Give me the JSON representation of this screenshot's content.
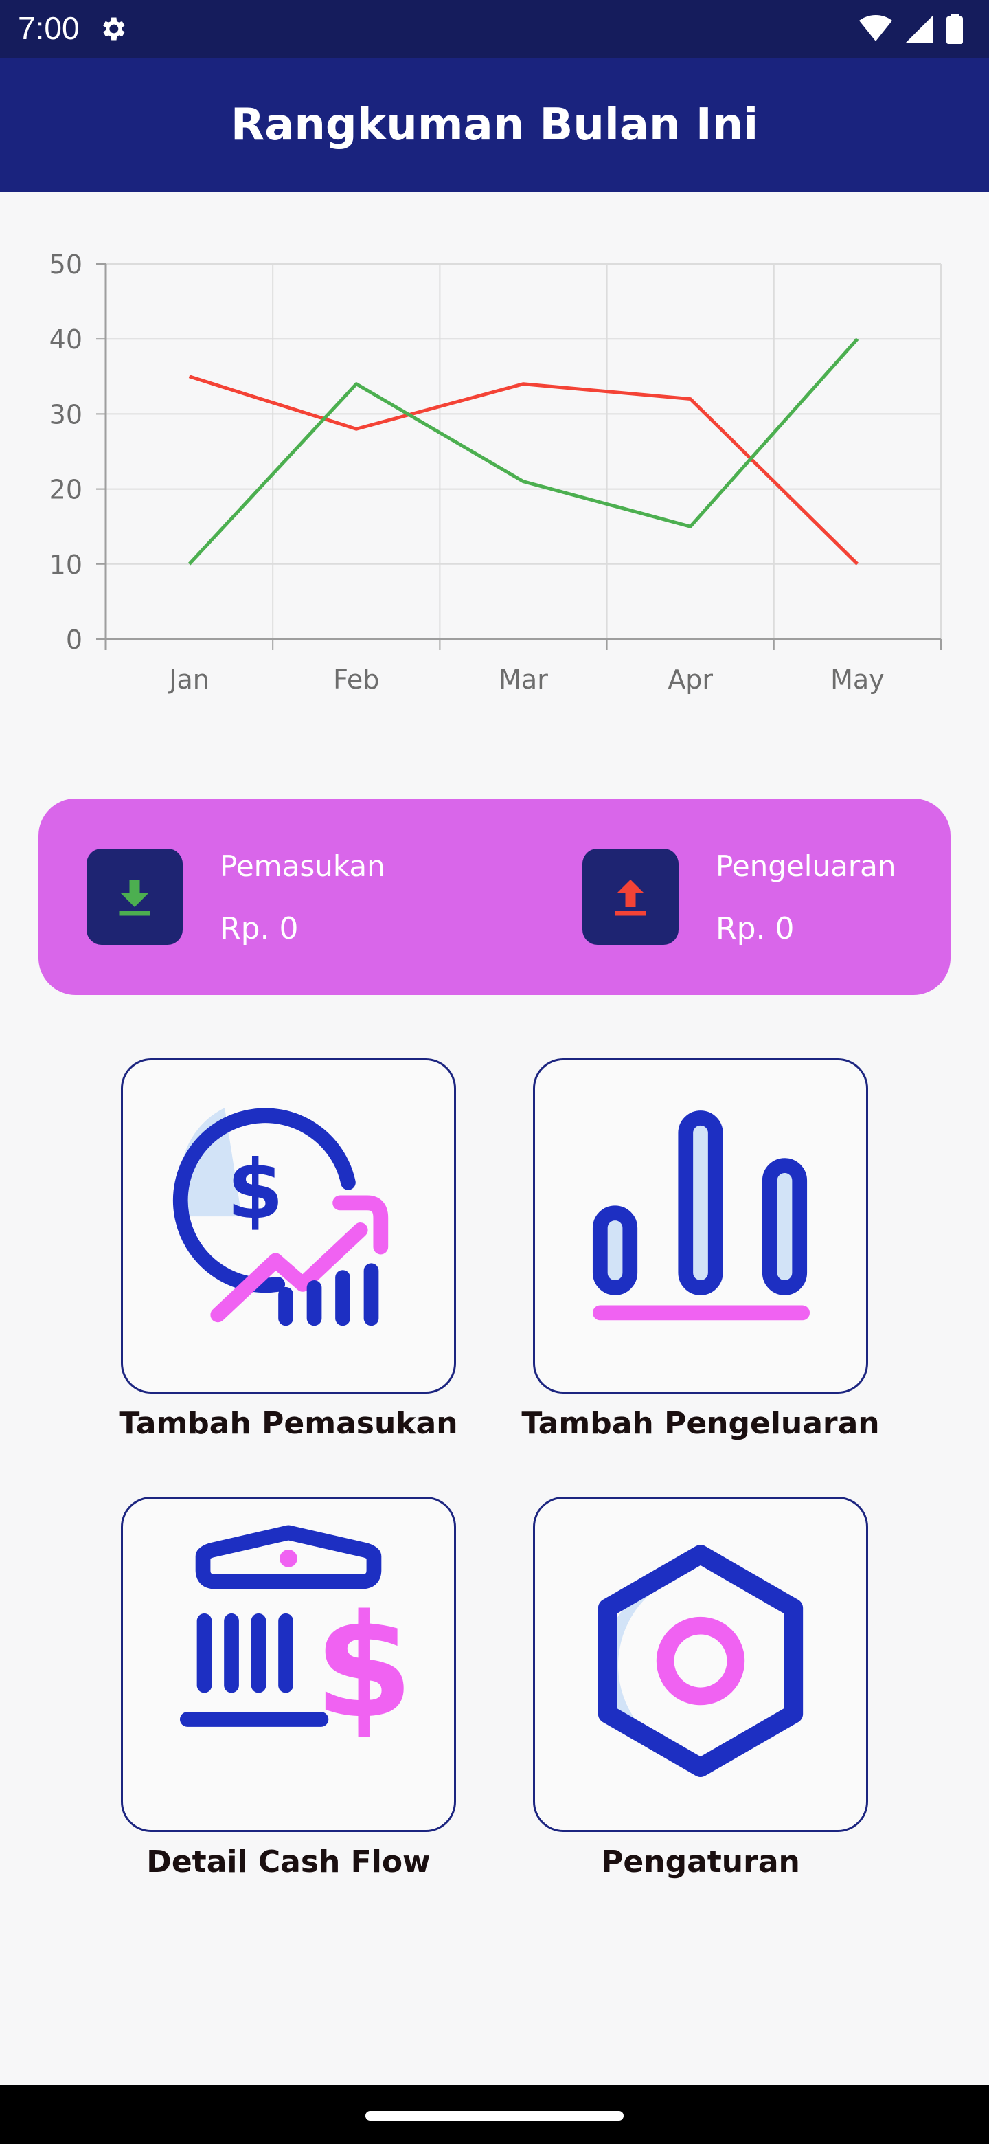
{
  "status_bar": {
    "time": "7:00"
  },
  "app_bar": {
    "title": "Rangkuman Bulan Ini"
  },
  "chart_data": {
    "type": "line",
    "categories": [
      "Jan",
      "Feb",
      "Mar",
      "Apr",
      "May"
    ],
    "yticks": [
      "0",
      "10",
      "20",
      "30",
      "40",
      "50"
    ],
    "ylim": [
      0,
      50
    ],
    "grid": true,
    "legend": "none",
    "series": [
      {
        "color": "#f44336",
        "values": [
          35,
          28,
          34,
          32,
          10
        ]
      },
      {
        "color": "#4caf50",
        "values": [
          10,
          34,
          21,
          15,
          40
        ]
      }
    ]
  },
  "summary": {
    "income": {
      "label": "Pemasukan",
      "value": "Rp. 0",
      "icon": "download-icon",
      "icon_color": "#4caf50"
    },
    "expense": {
      "label": "Pengeluaran",
      "value": "Rp. 0",
      "icon": "upload-icon",
      "icon_color": "#f44336"
    }
  },
  "menu": [
    {
      "label": "Tambah Pemasukan",
      "icon": "money-growth-icon"
    },
    {
      "label": "Tambah Pengeluaran",
      "icon": "bar-chart-icon"
    },
    {
      "label": "Detail Cash Flow",
      "icon": "bank-dollar-icon"
    },
    {
      "label": "Pengaturan",
      "icon": "settings-gear-icon"
    }
  ],
  "colors": {
    "primary": "#1a237e",
    "accent": "#d966ea",
    "icon_blue": "#1d2fc2",
    "icon_pink": "#f062f2",
    "icon_fill": "#d2e3f7"
  }
}
